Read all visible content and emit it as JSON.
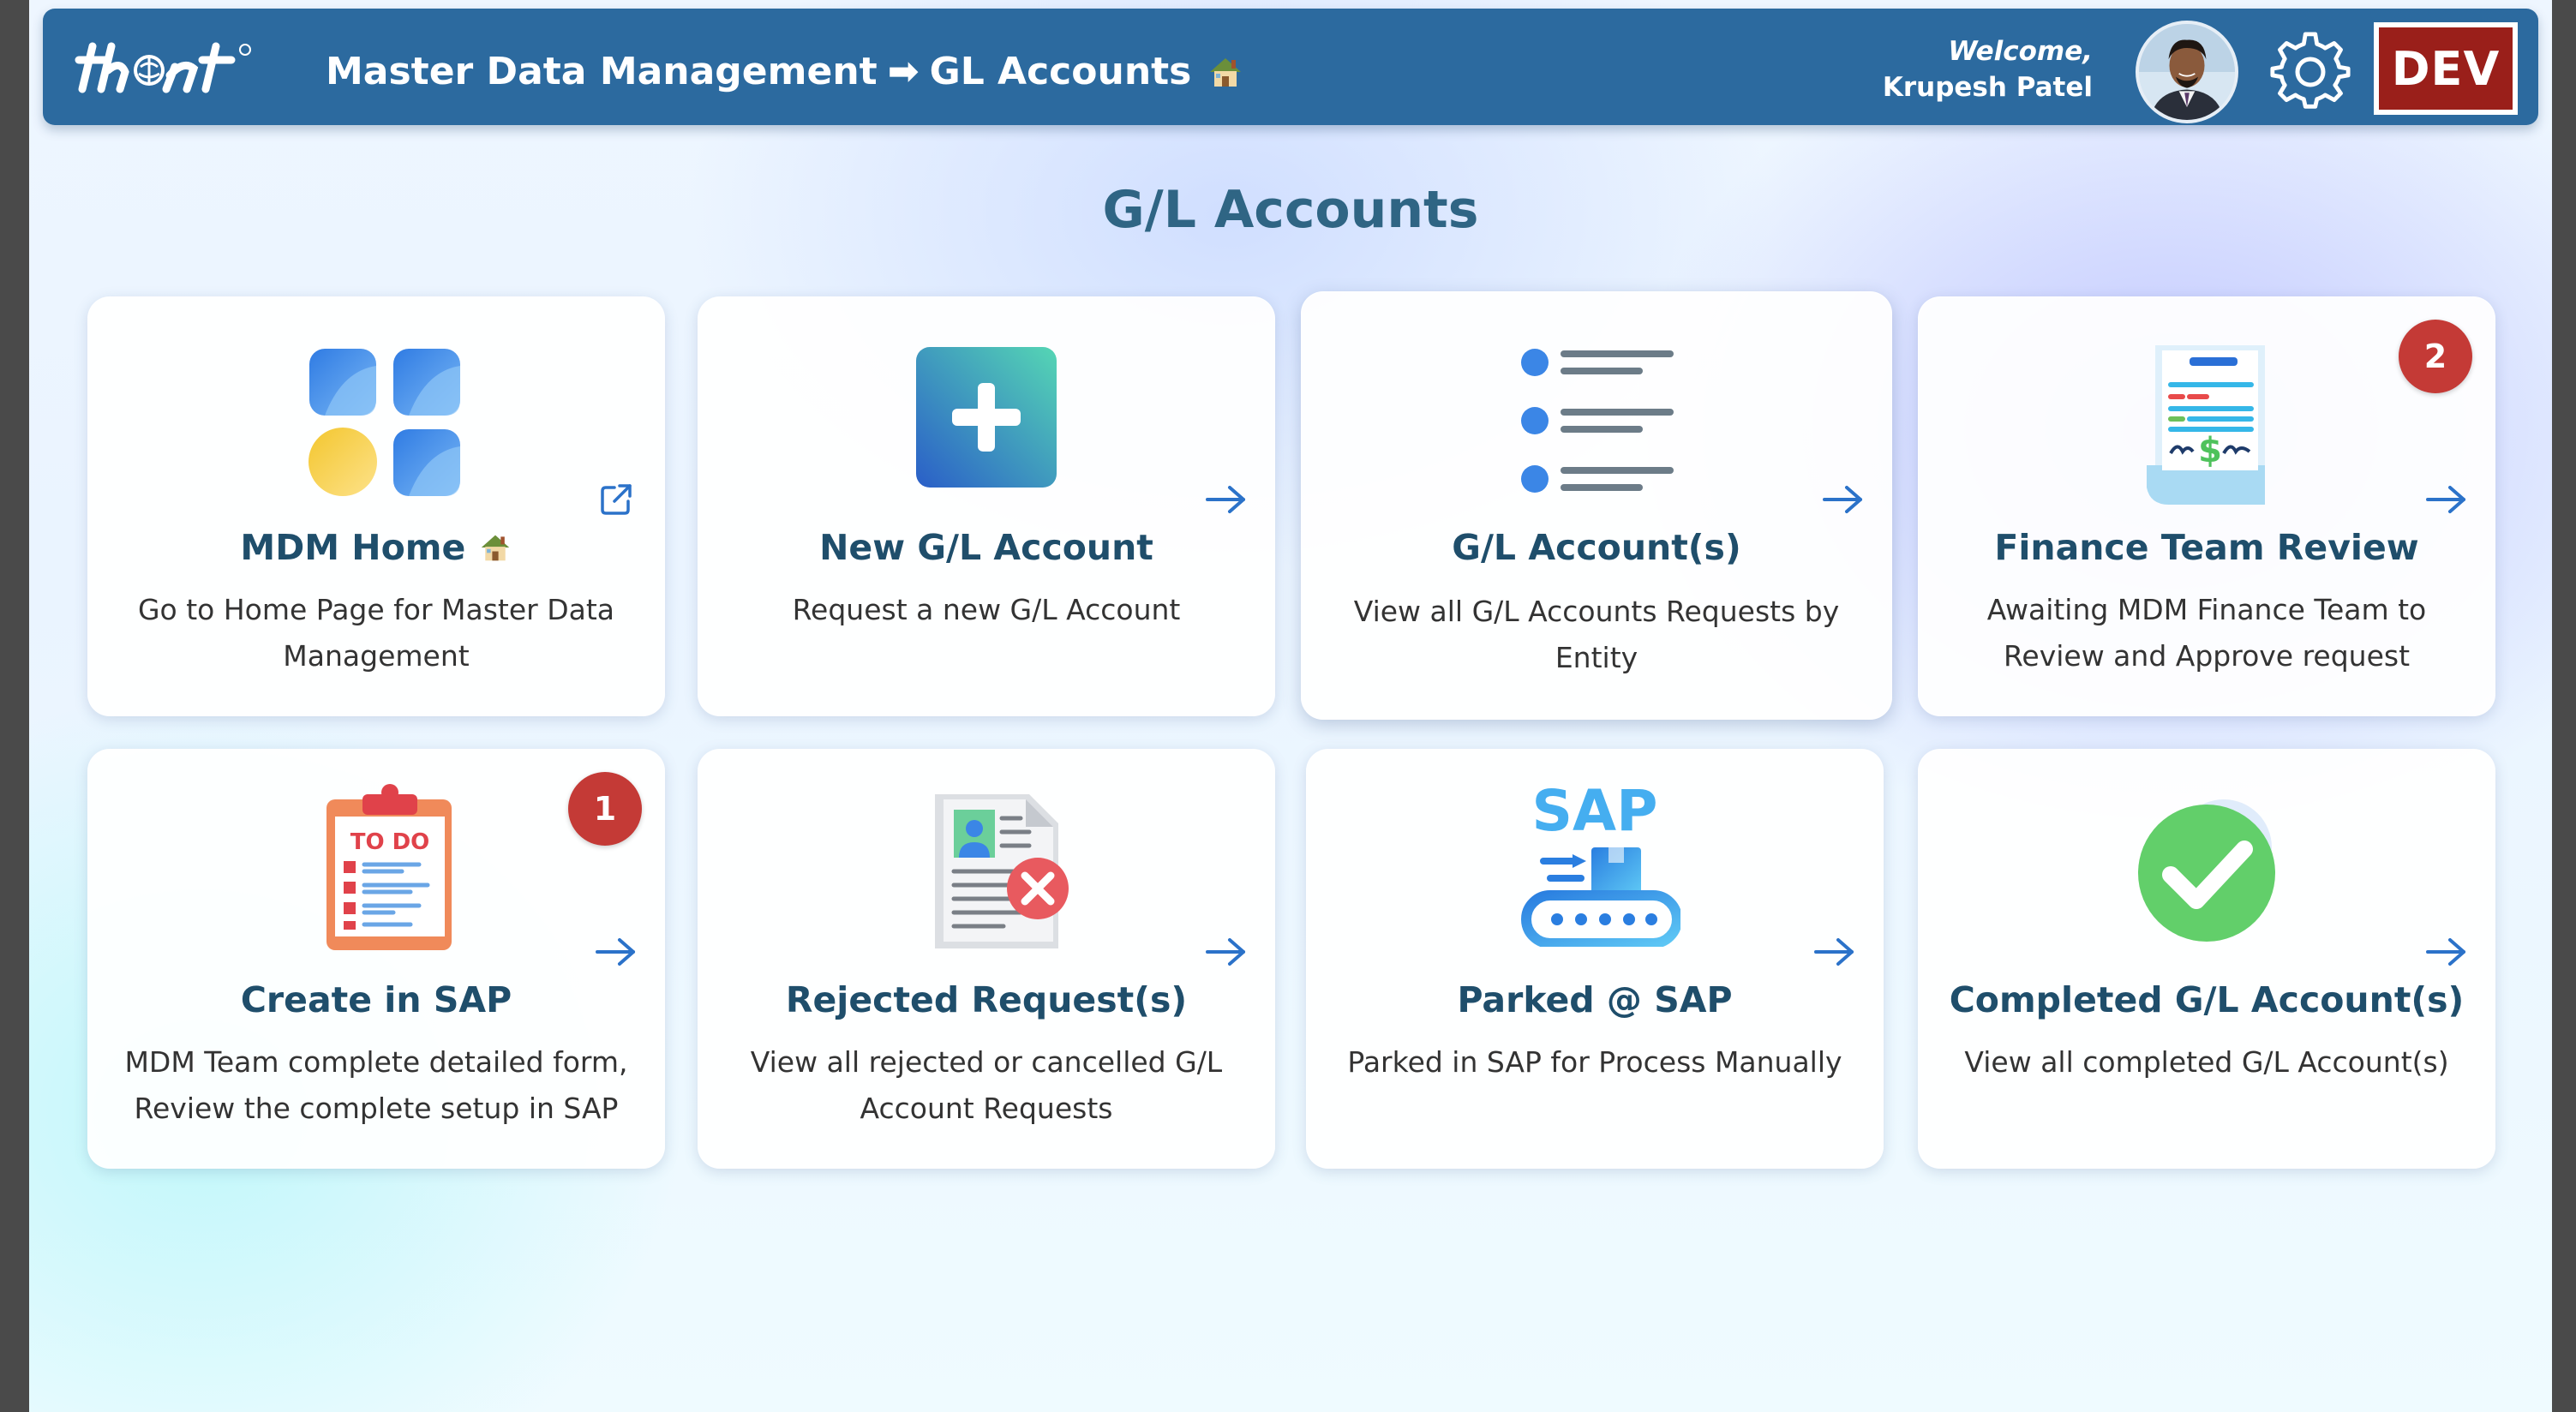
{
  "header": {
    "breadcrumb_section": "Master Data Management",
    "breadcrumb_arrow": "➡",
    "breadcrumb_page": "GL Accounts",
    "welcome_label": "Welcome,",
    "user_name": "Krupesh Patel",
    "environment": "DEV"
  },
  "page_title": "G/L Accounts",
  "cards": [
    {
      "title": "MDM Home",
      "title_icon": "house-icon",
      "description": "Go to Home Page for Master Data Management",
      "action_icon": "external-link-icon"
    },
    {
      "title": "New G/L Account",
      "description": "Request a new G/L Account",
      "action_icon": "arrow-right-icon"
    },
    {
      "title": "G/L Account(s)",
      "description": "View all G/L Accounts Requests by Entity",
      "action_icon": "arrow-right-icon"
    },
    {
      "title": "Finance Team Review",
      "description": "Awaiting MDM Finance Team to Review and Approve request",
      "badge": "2",
      "action_icon": "arrow-right-icon"
    },
    {
      "title": "Create in SAP",
      "description": "MDM Team complete detailed form, Review the complete setup in SAP",
      "badge": "1",
      "icon_text": "TO DO",
      "action_icon": "arrow-right-icon"
    },
    {
      "title": "Rejected Request(s)",
      "description": "View all rejected or cancelled G/L Account Requests",
      "action_icon": "arrow-right-icon"
    },
    {
      "title": "Parked @ SAP",
      "description": "Parked in SAP for Process Manually",
      "icon_text": "SAP",
      "action_icon": "arrow-right-icon"
    },
    {
      "title": "Completed G/L Account(s)",
      "description": "View all completed G/L Account(s)",
      "action_icon": "arrow-right-icon"
    }
  ],
  "colors": {
    "header_bg": "#2c6a9f",
    "title_text": "#2f6584",
    "card_title": "#1f4e6b",
    "badge_bg": "#c43a36",
    "env_badge_bg": "#9a1f1a",
    "arrow": "#2b72c9"
  }
}
